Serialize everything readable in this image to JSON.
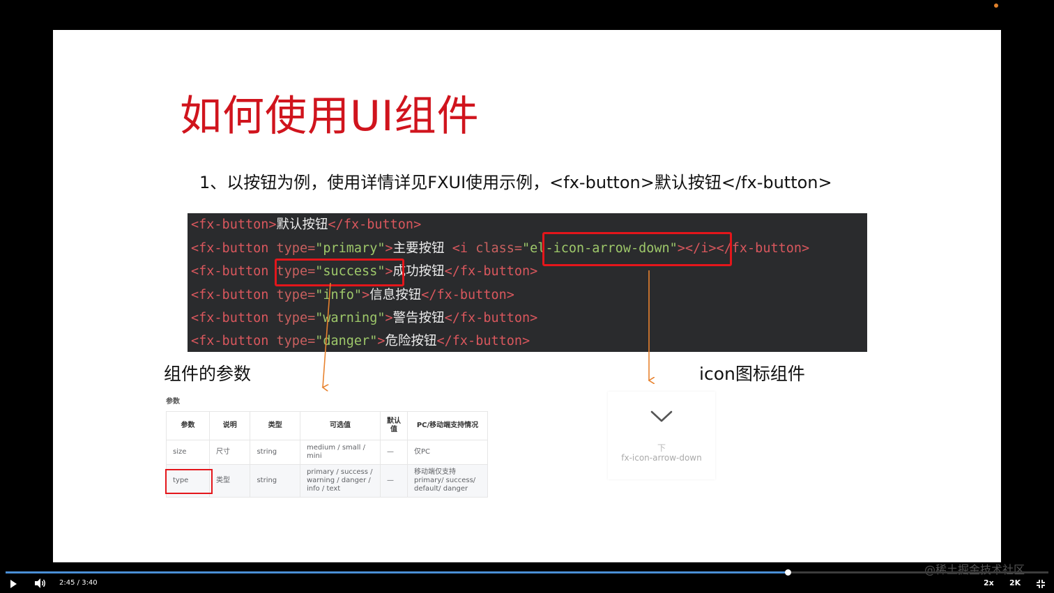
{
  "slide": {
    "title": "如何使用UI组件",
    "subtitle": "1、以按钮为例，使用详情详见FXUI使用示例，<fx-button>默认按钮</fx-button>",
    "code": {
      "l1": {
        "t1": "<fx-button>",
        "x1": "默认按钮",
        "t2": "</fx-button>"
      },
      "l2": {
        "t1": "<fx-button ",
        "a1": "type=",
        "s1": "\"primary\"",
        "t2": ">",
        "x1": "主要按钮",
        "t3": " <i ",
        "a2": "class=",
        "s2": "\"el-icon-arrow-down\"",
        "t4": "></i></fx-button>"
      },
      "l3": {
        "t1": "<fx-button ",
        "a1": "type=",
        "s1": "\"success\"",
        "t2": ">",
        "x1": "成功按钮",
        "t3": "</fx-button>"
      },
      "l4": {
        "t1": "<fx-button ",
        "a1": "type=",
        "s1": "\"info\"",
        "t2": ">",
        "x1": "信息按钮",
        "t3": "</fx-button>"
      },
      "l5": {
        "t1": "<fx-button ",
        "a1": "type=",
        "s1": "\"warning\"",
        "t2": ">",
        "x1": "警告按钮",
        "t3": "</fx-button>"
      },
      "l6": {
        "t1": "<fx-button ",
        "a1": "type=",
        "s1": "\"danger\"",
        "t2": ">",
        "x1": "危险按钮",
        "t3": "</fx-button>"
      }
    },
    "params_label": "组件的参数",
    "icon_label": "icon图标组件",
    "params_table": {
      "caption": "参数",
      "headers": [
        "参数",
        "说明",
        "类型",
        "可选值",
        "默认值",
        "PC/移动端支持情况"
      ],
      "rows": [
        [
          "size",
          "尺寸",
          "string",
          "medium / small / mini",
          "—",
          "仅PC"
        ],
        [
          "type",
          "类型",
          "string",
          "primary / success / warning / danger / info / text",
          "—",
          "移动端仅支持 primary/ success/ default/ danger"
        ]
      ]
    },
    "icon_card": {
      "icon": "chevron-down-icon",
      "cn": "下",
      "en": "fx-icon-arrow-down"
    }
  },
  "player": {
    "current_time": "2:45",
    "duration": "3:40",
    "progress": 0.75,
    "speed": "2x",
    "quality": "2K",
    "watermark": "@稀土掘金技术社区"
  },
  "colors": {
    "title": "#d0141d",
    "highlight": "#e4161b",
    "arrow": "#e8822e",
    "progress": "#4a8fd6"
  }
}
